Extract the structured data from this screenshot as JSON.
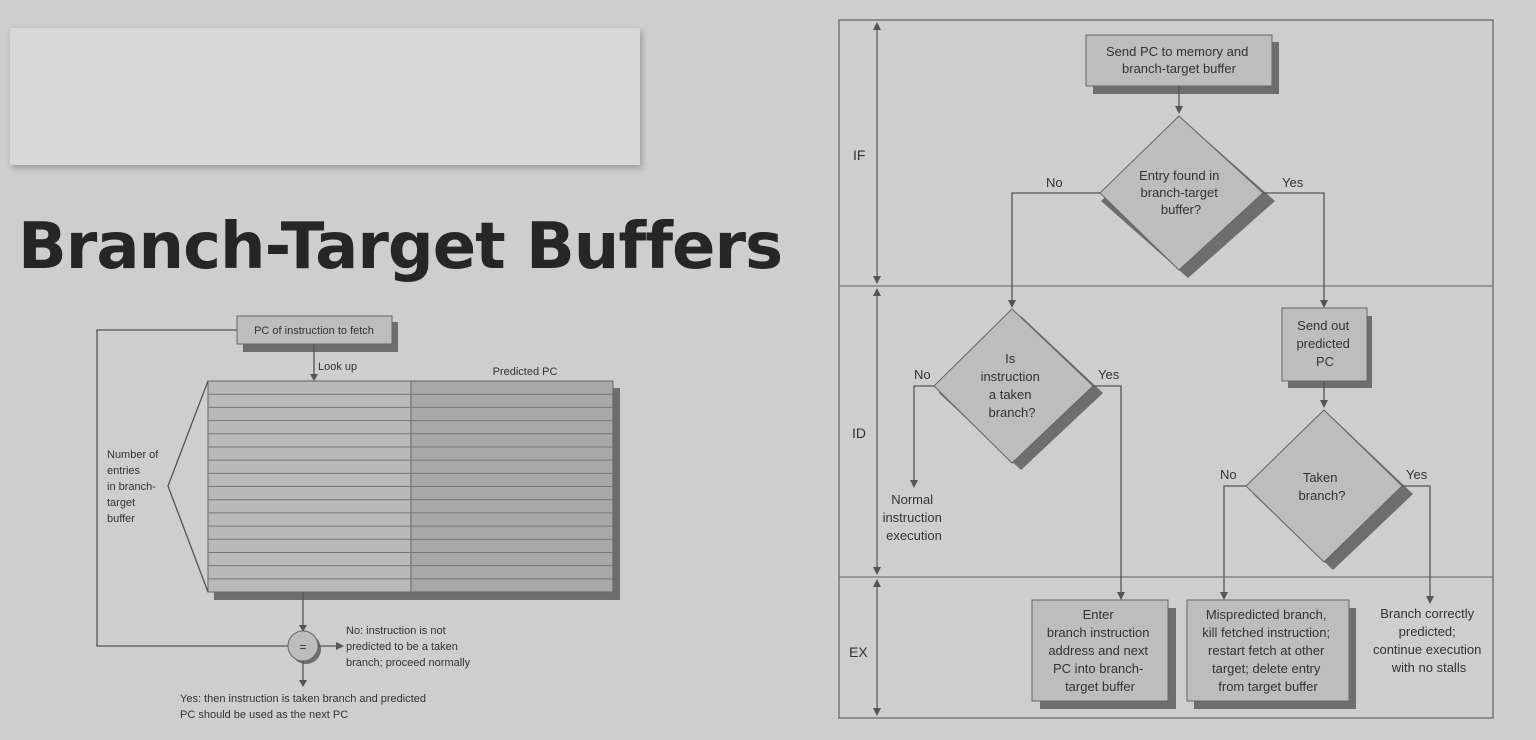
{
  "slide": {
    "title": "Branch-Target Buffers"
  },
  "left_diagram": {
    "pc_box": "PC of instruction to fetch",
    "lookup": "Look up",
    "predicted_pc": "Predicted PC",
    "entries_label": [
      "Number of",
      "entries",
      "in branch-",
      "target",
      "buffer"
    ],
    "compare_symbol": "=",
    "no_note": [
      "No:  instruction is not",
      "predicted to be a taken",
      "branch; proceed normally"
    ],
    "yes_note": [
      "Yes:  then instruction is taken branch and predicted",
      "PC should be used as the next PC"
    ]
  },
  "flowchart": {
    "stages": [
      "IF",
      "ID",
      "EX"
    ],
    "send_pc": [
      "Send PC to memory and",
      "branch-target buffer"
    ],
    "entry_found": [
      "Entry found in",
      "branch-target",
      "buffer?"
    ],
    "no": "No",
    "yes": "Yes",
    "is_taken": [
      "Is",
      "instruction",
      "a taken",
      "branch?"
    ],
    "normal": [
      "Normal",
      "instruction",
      "execution"
    ],
    "send_out": [
      "Send out",
      "predicted",
      "PC"
    ],
    "taken_branch": [
      "Taken",
      "branch?"
    ],
    "enter_box": [
      "Enter",
      "branch instruction",
      "address and next",
      "PC into branch-",
      "target buffer"
    ],
    "mispredict_box": [
      "Mispredicted branch,",
      "kill fetched instruction;",
      "restart fetch at other",
      "target; delete entry",
      "from target buffer"
    ],
    "correct": [
      "Branch correctly",
      "predicted;",
      "continue execution",
      "with no stalls"
    ]
  }
}
